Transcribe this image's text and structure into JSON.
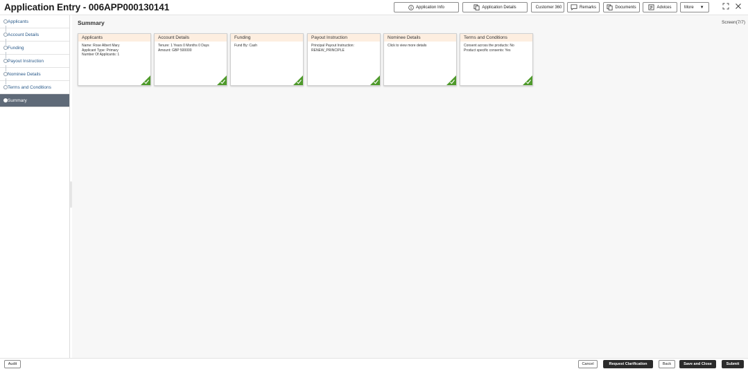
{
  "header": {
    "title": "Application Entry - 006APP000130141",
    "buttons": [
      {
        "label": "Application Info",
        "icon": "info-icon"
      },
      {
        "label": "Application Details",
        "icon": "document-copy-icon"
      },
      {
        "label": "Customer 360",
        "icon": "customer-card-icon"
      },
      {
        "label": "Remarks",
        "icon": "comment-icon"
      },
      {
        "label": "Documents",
        "icon": "documents-icon"
      },
      {
        "label": "Advices",
        "icon": "advices-icon"
      }
    ],
    "more_label": "More"
  },
  "sidebar": {
    "items": [
      {
        "label": "Applicants"
      },
      {
        "label": "Account Details"
      },
      {
        "label": "Funding"
      },
      {
        "label": "Payout Instruction"
      },
      {
        "label": "Nominee Details"
      },
      {
        "label": "Terms and Conditions"
      },
      {
        "label": "Summary",
        "active": true
      }
    ]
  },
  "main": {
    "title": "Summary",
    "screen_count": "Screen(7/7)",
    "cards": [
      {
        "title": "Applicants",
        "lines": [
          "Name: Rose Albert Mary",
          "Applicant Type: Primary",
          "Number Of Applicants: 1"
        ]
      },
      {
        "title": "Account Details",
        "lines": [
          "Tenure: 1 Years 0 Months 0 Days",
          "Amount: GBP 500000"
        ]
      },
      {
        "title": "Funding",
        "lines": [
          "Fund By: Cash"
        ]
      },
      {
        "title": "Payout Instruction",
        "lines": [
          "Principal Payout Instruction:",
          "RENEW_PRINCIPLE"
        ]
      },
      {
        "title": "Nominee Details",
        "lines": [
          "Click to view more details"
        ]
      },
      {
        "title": "Terms and Conditions",
        "lines": [
          "Consent across the products: No",
          "Product specific consents: Yes"
        ]
      }
    ]
  },
  "footer": {
    "audit": "Audit",
    "cancel": "Cancel",
    "request_clarification": "Request Clarification",
    "back": "Back",
    "save_and_close": "Save and Close",
    "submit": "Submit"
  },
  "colors": {
    "card_header": "#fdeee0",
    "check_green": "#4e9a2a",
    "active_nav": "#5f6a78",
    "primary_button": "#2b2b2b"
  }
}
